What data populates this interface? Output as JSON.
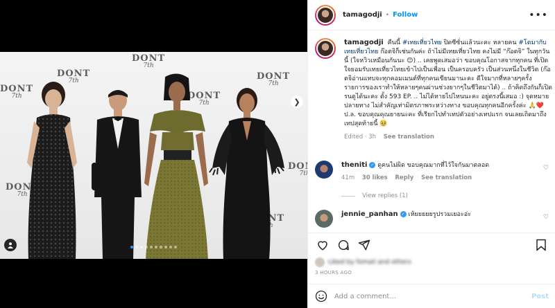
{
  "header": {
    "username": "tamagodji",
    "separator": "•",
    "follow_label": "Follow",
    "more_label": "•••"
  },
  "caption": {
    "username": "tamagodji",
    "segments": [
      {
        "text": "คืนนี้ ",
        "hashtag": false
      },
      {
        "text": "#เทยเที่ยวไทย",
        "hashtag": true
      },
      {
        "text": " ปิดซีซั่นแล้วนะคะ หลายคน ",
        "hashtag": false
      },
      {
        "text": "#โตมากับเทยเที่ยวไทย",
        "hashtag": true
      },
      {
        "text": " ก๊อตจิก็เช่นกันค่ะ ถ้าไม่มีเทยเที่ยวไทย คงไม่มี “ก๊อตจิ” ในทุกวันนี้ (ใจหวิวเหมือนกันนะ 😊) .. เคยพูดเสมอว่า ขอบคุณโอกาสจากทุกคน ที่เปิดใจยอมรับเทยเที่ยวไทยเข้าไปเป็นเพื่อน เป็นครอบครัว เป็นส่วนหนึ่งในชีวิต (ก๊อตจิอ่านแทบจะทุกคอมเมนต์ที่ทุกคนเขียนมานะคะ ดีใจมากที่หลายๆครั้ง รายการของเราทำให้หลายๆคนผ่านช่วงยากๆในชีวิตมาได้) .. ถ้าคิดถึงกันก็เปิดรนดูได้นะคะ ตั้ง 593 EP. .. ไม่ได้หายไปไหนนะคะ อยู่ตรงนี้เสมอ :) จุดหมายปลายทาง ไม่สำคัญเท่ามิตรภาพระหว่างทาง ขอบคุณทุกคนอีกครั้งค่ะ 🙏❤️ ป.ล. ขอบคุณคุณยายนะคะ ที่เรียกไปทำเทปตัวอย่างเทปแรก จนเลยเถิดมาถึงเทปสุดท้ายนี้ 🥹",
        "hashtag": false
      }
    ],
    "edited": "Edited · 3h",
    "see_translation": "See translation"
  },
  "comments": [
    {
      "username": "theniti",
      "verified": true,
      "text": "ดูคนไม่ผิด ขอบคุณมากที่ไว้ใจกันมาตลอด",
      "time": "41m",
      "likes": "30 likes",
      "reply": "Reply",
      "see_translation": "See translation",
      "heart": "♡"
    },
    {
      "username": "jennie_panhan",
      "verified": true,
      "text": "เห้ยยยยยรูปรวมเยอะอ่ะ",
      "time": "",
      "likes": "",
      "reply": "",
      "see_translation": "",
      "heart": "♡"
    }
  ],
  "view_replies": "View replies (1)",
  "likes_text": "Liked by fomail and others",
  "timestamp": "3 HOURS AGO",
  "add_comment": {
    "placeholder": "Add a comment...",
    "post_label": "Post"
  },
  "watermark": {
    "main": "DONT",
    "sub": "7th"
  },
  "carousel": {
    "count": 10,
    "active": 0
  },
  "icons": [
    "heart-icon",
    "comment-icon",
    "share-icon",
    "bookmark-icon",
    "emoji-icon",
    "user-tag-icon",
    "chevron-right-icon"
  ],
  "colors": {
    "accent": "#0095f6",
    "hashtag": "#00376b",
    "muted": "#8e8e8e"
  }
}
